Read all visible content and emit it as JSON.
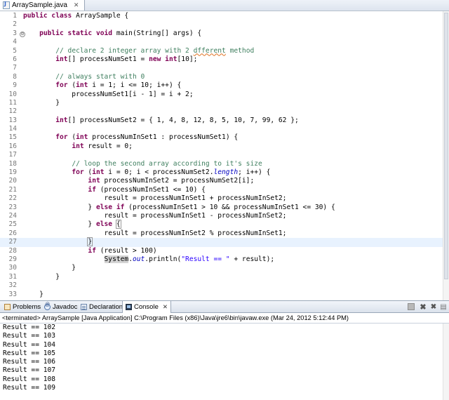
{
  "editor": {
    "tab_title": "ArraySample.java",
    "tab_close": "✕"
  },
  "code_lines": [
    {
      "n": "1",
      "html": "<span class='kw'>public class</span> ArraySample {",
      "fold": ""
    },
    {
      "n": "2",
      "html": "",
      "fold": ""
    },
    {
      "n": "3",
      "html": "    <span class='kw'>public static void</span> main(String[] args) {",
      "fold": "⊖"
    },
    {
      "n": "4",
      "html": "",
      "fold": ""
    },
    {
      "n": "5",
      "html": "        <span class='cm'>// declare 2 integer array with 2 <span class='sq'>dfferent</span> method</span>",
      "fold": ""
    },
    {
      "n": "6",
      "html": "        <span class='kw'>int</span>[] processNumSet1 = <span class='kw'>new int</span>[10];",
      "fold": ""
    },
    {
      "n": "7",
      "html": "",
      "fold": ""
    },
    {
      "n": "8",
      "html": "        <span class='cm'>// always start with 0</span>",
      "fold": ""
    },
    {
      "n": "9",
      "html": "        <span class='kw'>for</span> (<span class='kw'>int</span> i = 1; i &lt;= 10; i++) {",
      "fold": ""
    },
    {
      "n": "10",
      "html": "            processNumSet1[i - 1] = i + 2;",
      "fold": ""
    },
    {
      "n": "11",
      "html": "        }",
      "fold": ""
    },
    {
      "n": "12",
      "html": "",
      "fold": ""
    },
    {
      "n": "13",
      "html": "        <span class='kw'>int</span>[] processNumSet2 = { 1, 4, 8, 12, 8, 5, 10, 7, 99, 62 };",
      "fold": ""
    },
    {
      "n": "14",
      "html": "",
      "fold": ""
    },
    {
      "n": "15",
      "html": "        <span class='kw'>for</span> (<span class='kw'>int</span> processNumInSet1 : processNumSet1) {",
      "fold": ""
    },
    {
      "n": "16",
      "html": "            <span class='kw'>int</span> result = 0;",
      "fold": ""
    },
    {
      "n": "17",
      "html": "",
      "fold": ""
    },
    {
      "n": "18",
      "html": "            <span class='cm'>// loop the second array according to it's size</span>",
      "fold": ""
    },
    {
      "n": "19",
      "html": "            <span class='kw'>for</span> (<span class='kw'>int</span> i = 0; i &lt; processNumSet2.<span class='fld'>length</span>; i++) {",
      "fold": ""
    },
    {
      "n": "20",
      "html": "                <span class='kw'>int</span> processNumInSet2 = processNumSet2[i];",
      "fold": ""
    },
    {
      "n": "21",
      "html": "                <span class='kw'>if</span> (processNumInSet1 &lt;= 10) {",
      "fold": ""
    },
    {
      "n": "22",
      "html": "                    result = processNumInSet1 + processNumInSet2;",
      "fold": ""
    },
    {
      "n": "23",
      "html": "                } <span class='kw'>else if</span> (processNumInSet1 &gt; 10 &amp;&amp; processNumInSet1 &lt;= 30) {",
      "fold": ""
    },
    {
      "n": "24",
      "html": "                    result = processNumInSet1 - processNumInSet2;",
      "fold": ""
    },
    {
      "n": "25",
      "html": "                } <span class='kw'>else</span> <span class='bracket'>{</span>",
      "fold": ""
    },
    {
      "n": "26",
      "html": "                    result = processNumInSet2 % processNumInSet1;",
      "fold": ""
    },
    {
      "n": "27",
      "html": "                <span class='bracket'>}</span>",
      "fold": "",
      "current": true
    },
    {
      "n": "28",
      "html": "                <span class='kw'>if</span> (result &gt; 100)",
      "fold": ""
    },
    {
      "n": "29",
      "html": "                    <span class='hl'>System</span>.<span class='fld'>out</span>.println(<span class='str'>\"Result == \"</span> + result);",
      "fold": ""
    },
    {
      "n": "30",
      "html": "            }",
      "fold": ""
    },
    {
      "n": "31",
      "html": "        }",
      "fold": ""
    },
    {
      "n": "32",
      "html": "",
      "fold": ""
    },
    {
      "n": "33",
      "html": "    }",
      "fold": ""
    }
  ],
  "panel": {
    "tabs": [
      {
        "id": "problems",
        "label": "Problems"
      },
      {
        "id": "javadoc",
        "label": "Javadoc"
      },
      {
        "id": "declaration",
        "label": "Declaration"
      },
      {
        "id": "console",
        "label": "Console",
        "close": "✕"
      }
    ],
    "console_header": "<terminated> ArraySample [Java Application] C:\\Program Files (x86)\\Java\\jre6\\bin\\javaw.exe (Mar 24, 2012 5:12:44 PM)",
    "output": [
      "Result == 102",
      "Result == 103",
      "Result == 104",
      "Result == 105",
      "Result == 106",
      "Result == 107",
      "Result == 108",
      "Result == 109"
    ]
  },
  "colors": {
    "keyword": "#7f0055",
    "comment": "#3f7f5f",
    "string": "#2a00ff",
    "current_line": "#e8f2fe"
  }
}
